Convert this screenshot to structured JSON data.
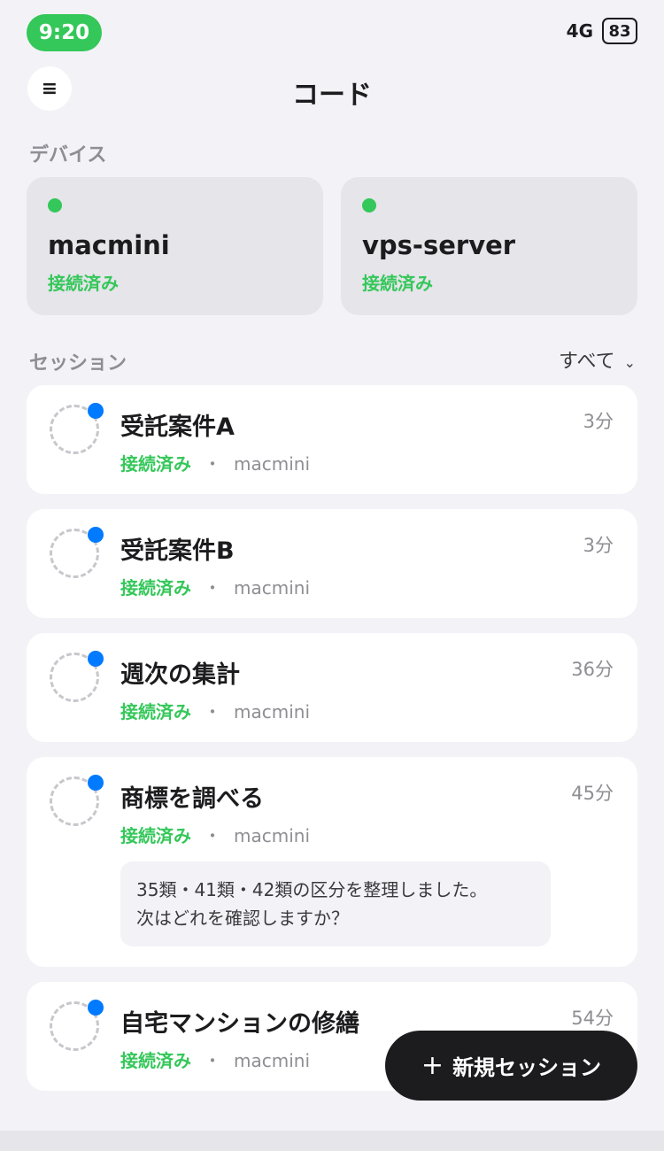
{
  "status_bar": {
    "time": "9:20",
    "network": "4G",
    "battery": "83"
  },
  "header": {
    "title": "コード",
    "menu_icon": "hamburger-icon"
  },
  "devices": {
    "label": "デバイス",
    "items": [
      {
        "name": "macmini",
        "status": "接続済み"
      },
      {
        "name": "vps-server",
        "status": "接続済み"
      }
    ]
  },
  "sessions": {
    "label": "セッション",
    "filter": "すべて",
    "items": [
      {
        "title": "受託案件A",
        "status": "接続済み",
        "sep": "・",
        "device": "macmini",
        "time": "3分"
      },
      {
        "title": "受託案件B",
        "status": "接続済み",
        "sep": "・",
        "device": "macmini",
        "time": "3分"
      },
      {
        "title": "週次の集計",
        "status": "接続済み",
        "sep": "・",
        "device": "macmini",
        "time": "36分"
      },
      {
        "title": "商標を調べる",
        "status": "接続済み",
        "sep": "・",
        "device": "macmini",
        "time": "45分",
        "preview_line1": "35類・41類・42類の区分を整理しました。",
        "preview_line2": "次はどれを確認しますか？"
      },
      {
        "title": "自宅マンションの修繕",
        "status": "接続済み",
        "sep": "・",
        "device": "macmini",
        "time": "54分"
      }
    ]
  },
  "fab": {
    "plus": "+",
    "label": "新規セッション"
  },
  "colors": {
    "accent_green": "#34c759",
    "unread_blue": "#007aff",
    "background": "#f2f2f7"
  }
}
